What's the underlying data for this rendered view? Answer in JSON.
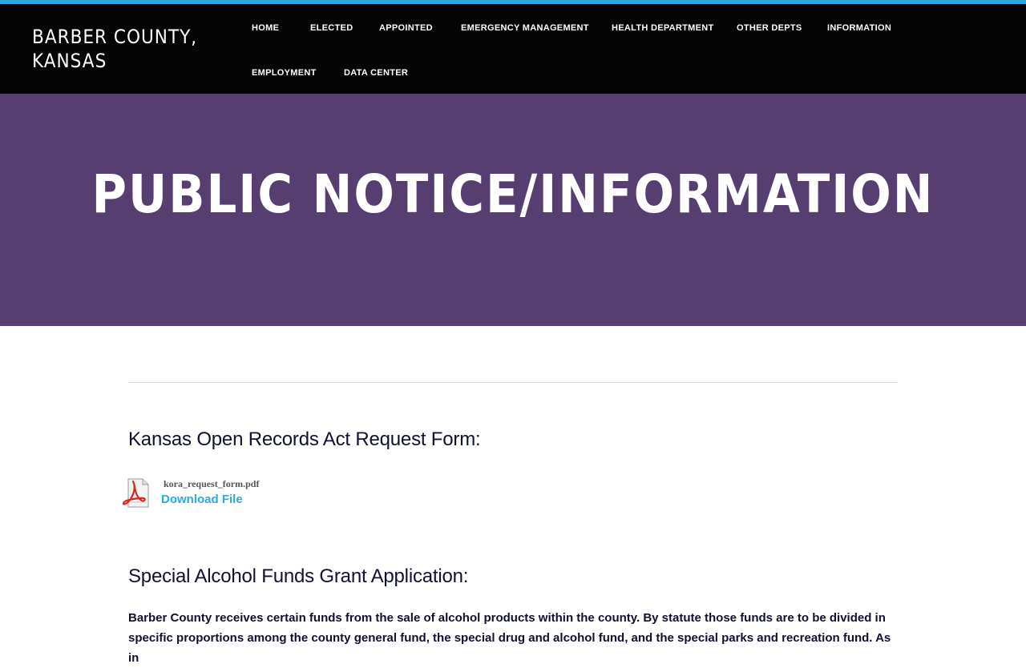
{
  "site": {
    "title": "BARBER COUNTY, KANSAS"
  },
  "nav": {
    "items": [
      {
        "label": "HOME"
      },
      {
        "label": "ELECTED"
      },
      {
        "label": "APPOINTED"
      },
      {
        "label": "EMERGENCY MANAGEMENT"
      },
      {
        "label": "HEALTH DEPARTMENT"
      },
      {
        "label": "OTHER DEPTS"
      },
      {
        "label": "INFORMATION"
      },
      {
        "label": "EMPLOYMENT"
      },
      {
        "label": "DATA CENTER"
      }
    ]
  },
  "hero": {
    "title": "PUBLIC NOTICE/INFORMATION"
  },
  "content": {
    "kora_heading": "Kansas Open Records Act Request Form:",
    "file": {
      "name": "kora_request_form.pdf",
      "download_label": "Download File",
      "icon": "pdf-file-icon"
    },
    "grant_heading": "Special Alcohol Funds Grant Application:",
    "grant_paragraph": "Barber County receives certain funds from the sale of alcohol products within the county. By statute those funds are to be divided in specific proportions among the county general fund, the special drug and alcohol fund, and the special parks and recreation fund. As in"
  },
  "colors": {
    "accent": "#2fa6dd",
    "header_bg": "#050505",
    "hero_bg": "#573e71",
    "heading_text": "#0f1130"
  }
}
